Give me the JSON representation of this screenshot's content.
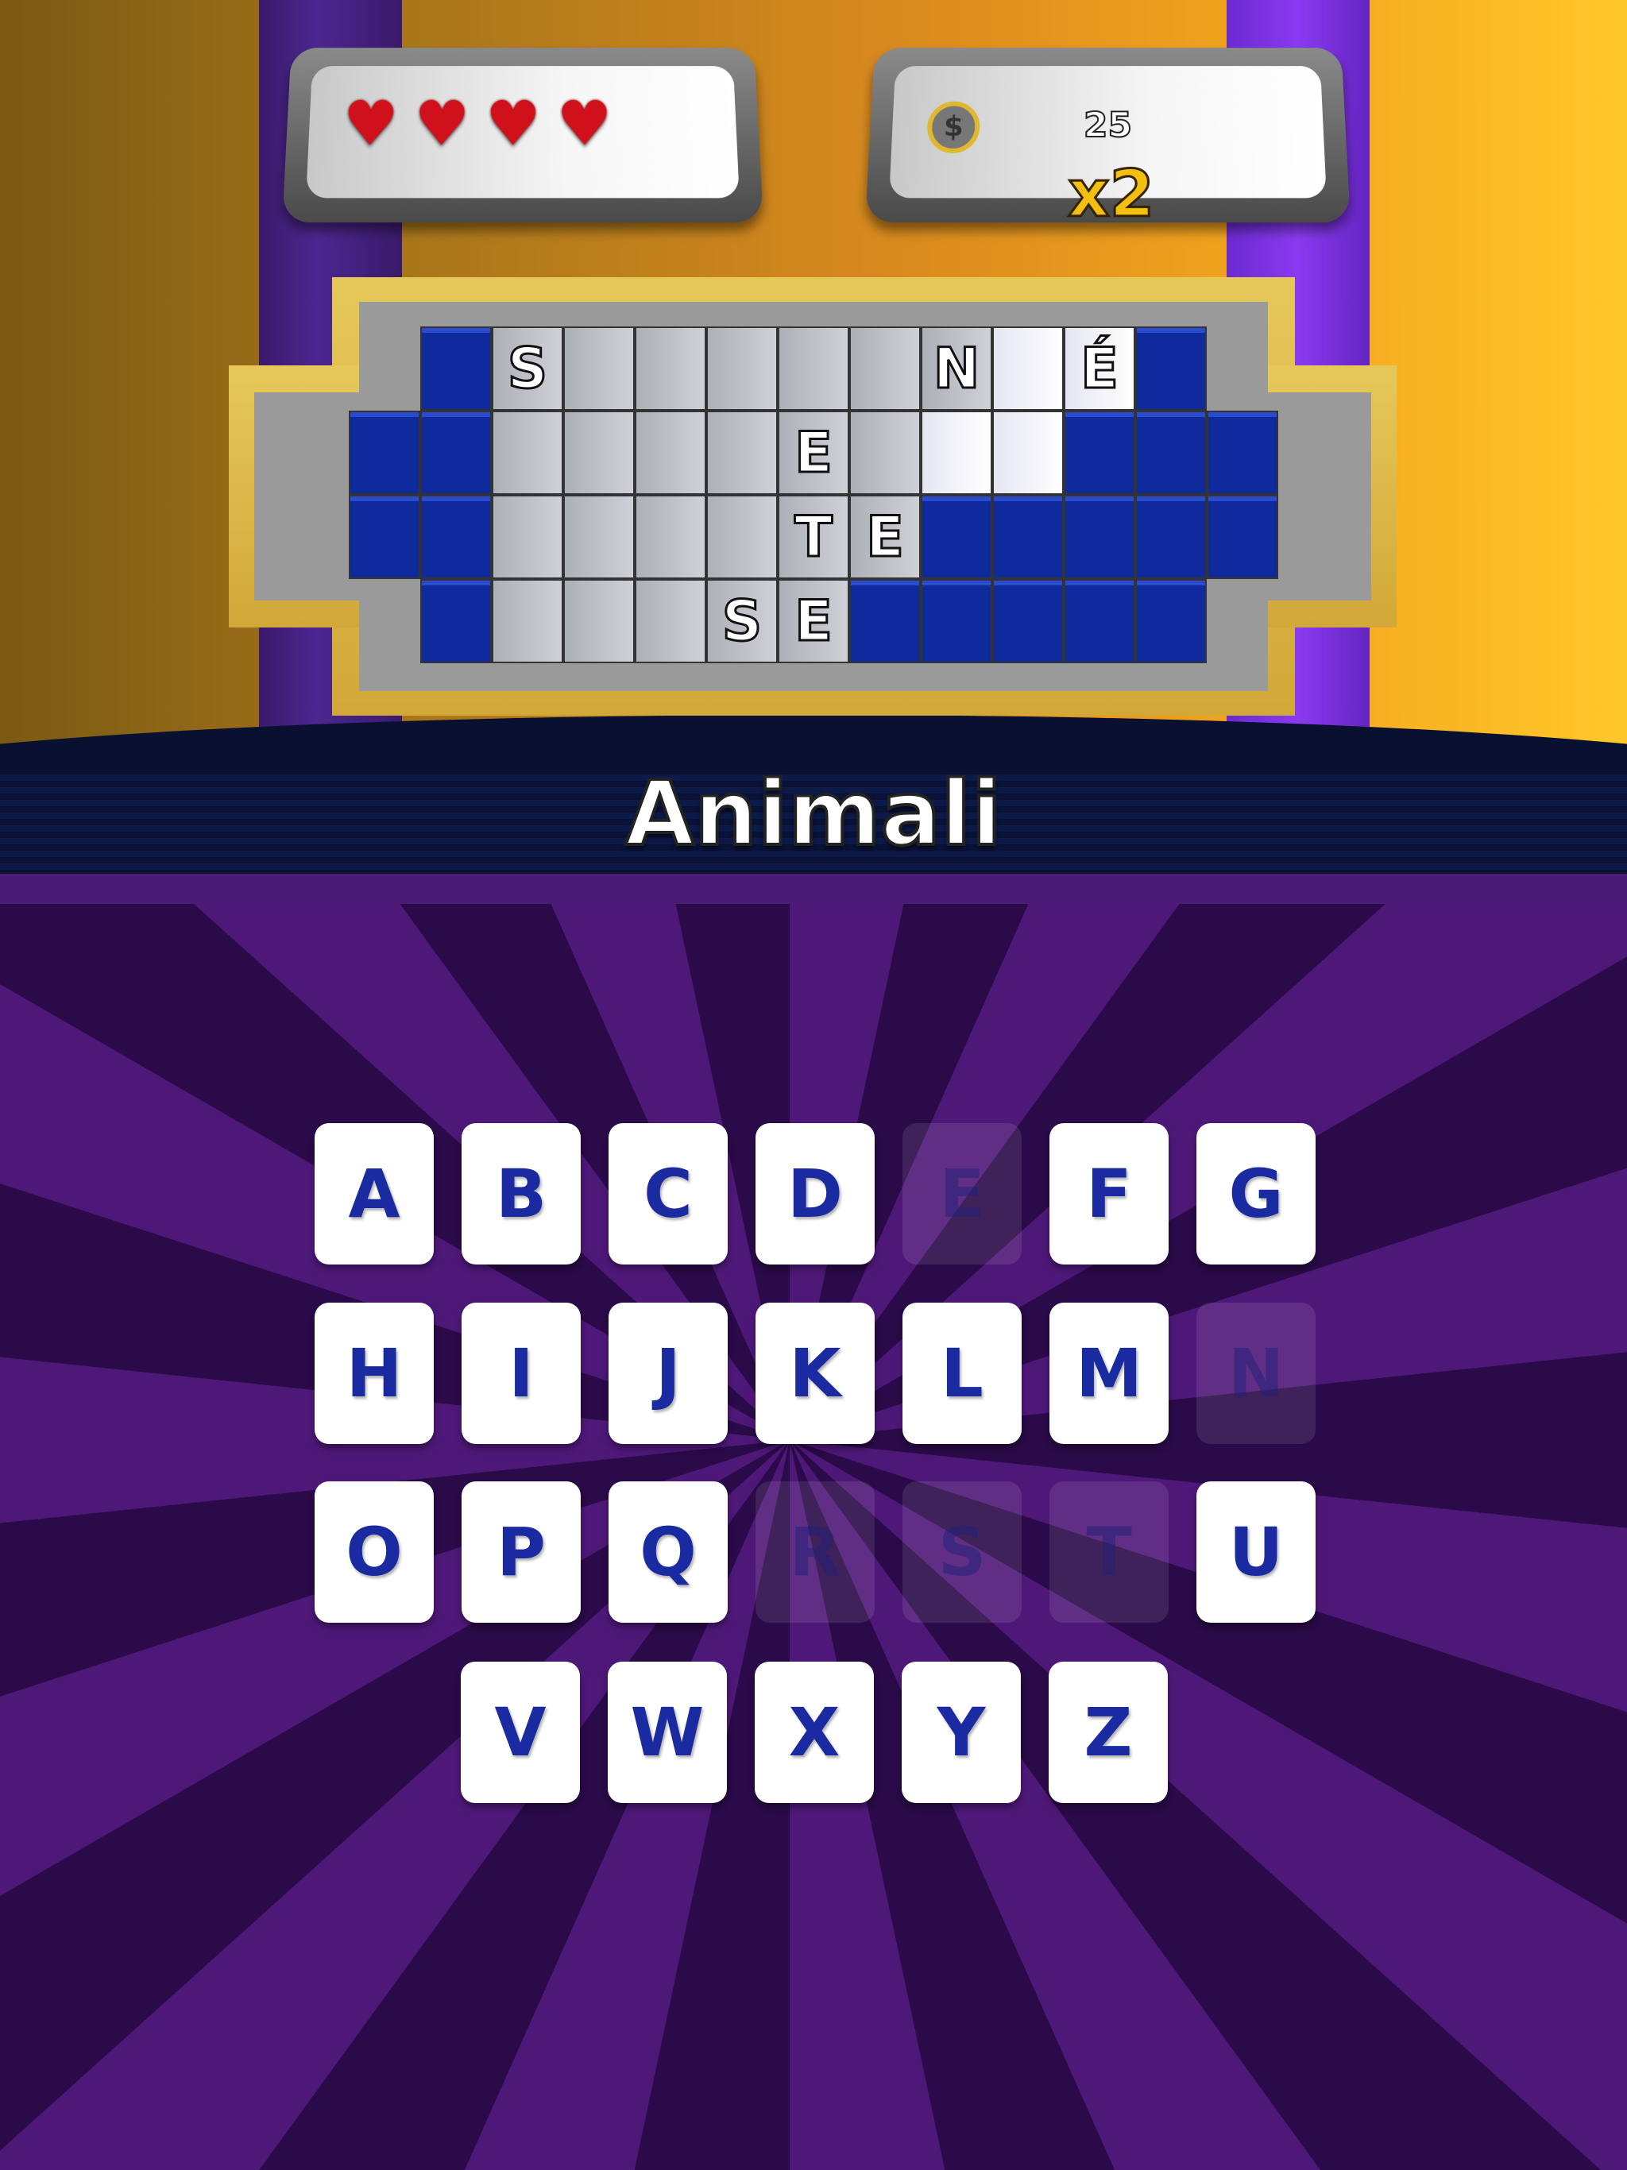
{
  "lives": {
    "count": 4,
    "icon": "heart-icon"
  },
  "coins": {
    "icon": "coin-icon",
    "symbol": "$",
    "score": "25",
    "multiplier": "x2"
  },
  "board": {
    "rows": [
      {
        "start": 1,
        "cells": [
          "B",
          "S",
          "G",
          "G",
          "G",
          "G",
          "G",
          "N",
          "W",
          "É",
          "B"
        ]
      },
      {
        "start": 0,
        "cells": [
          "B",
          "B",
          "G",
          "G",
          "G",
          "G",
          "E",
          "G",
          "W",
          "W",
          "B",
          "B",
          "B"
        ]
      },
      {
        "start": 0,
        "cells": [
          "B",
          "B",
          "G",
          "G",
          "G",
          "G",
          "T",
          "E",
          "B",
          "B",
          "B",
          "B",
          "B"
        ]
      },
      {
        "start": 1,
        "cells": [
          "B",
          "G",
          "G",
          "G",
          "S",
          "E",
          "B",
          "B",
          "B",
          "B",
          "B"
        ]
      }
    ]
  },
  "category": "Animali",
  "keyboard": {
    "rows": [
      [
        "A",
        "B",
        "C",
        "D",
        "E",
        "F",
        "G"
      ],
      [
        "H",
        "I",
        "J",
        "K",
        "L",
        "M",
        "N"
      ],
      [
        "O",
        "P",
        "Q",
        "R",
        "S",
        "T",
        "U"
      ],
      [
        "V",
        "W",
        "X",
        "Y",
        "Z"
      ]
    ],
    "used": [
      "E",
      "N",
      "R",
      "S",
      "T"
    ]
  }
}
